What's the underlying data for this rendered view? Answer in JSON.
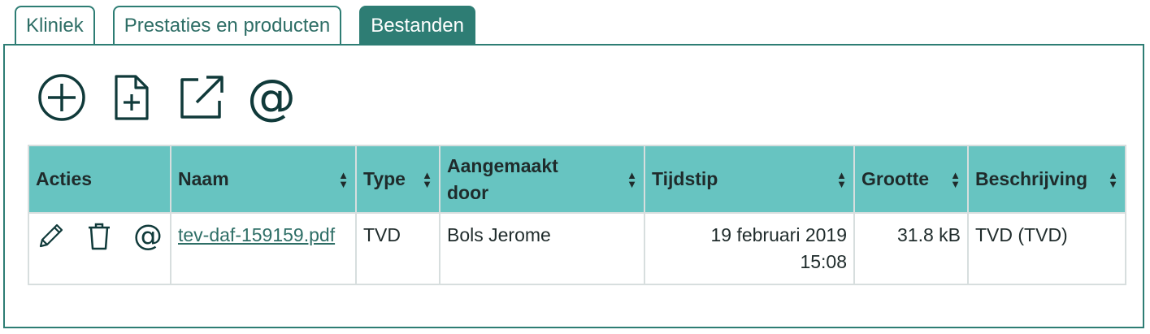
{
  "tabs": [
    {
      "label": "Kliniek"
    },
    {
      "label": "Prestaties en producten"
    },
    {
      "label": "Bestanden"
    }
  ],
  "toolbar": {
    "icons": [
      "add-circle-icon",
      "add-file-icon",
      "external-link-icon",
      "email-at-icon"
    ],
    "at_symbol": "@"
  },
  "table": {
    "columns": [
      "Acties",
      "Naam",
      "Type",
      "Aangemaakt door",
      "Tijdstip",
      "Grootte",
      "Beschrijving"
    ],
    "rows": [
      {
        "actions_at": "@",
        "naam": "tev-daf-159159.pdf",
        "type": "TVD",
        "aangemaakt_door": "Bols Jerome",
        "tijdstip_date": "19 februari 2019",
        "tijdstip_time": "15:08",
        "grootte": "31.8 kB",
        "beschrijving": "TVD (TVD)"
      }
    ]
  },
  "colors": {
    "accent": "#2e7d74",
    "header_bg": "#67c4c1",
    "icon": "#103a3a"
  }
}
